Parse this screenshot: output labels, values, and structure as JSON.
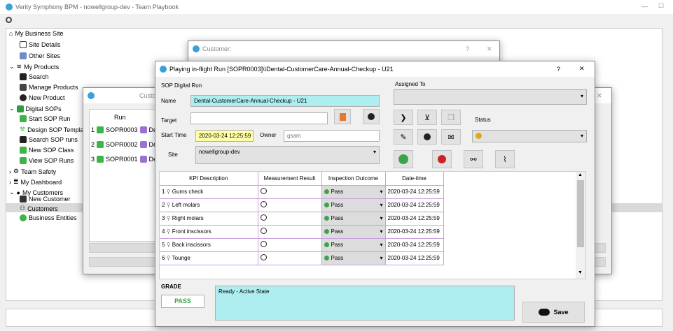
{
  "app": {
    "title": "Verity Symphony BPM - nowellgroup-dev - Team Playbook",
    "minimize": "—",
    "maximize": "☐"
  },
  "tree": {
    "items": [
      {
        "label": "My Business Site"
      },
      {
        "label": "Site Details"
      },
      {
        "label": "Other Sites"
      },
      {
        "label": "My Products"
      },
      {
        "label": "Search"
      },
      {
        "label": "Manage Products"
      },
      {
        "label": "New Product"
      },
      {
        "label": "Digital SOPs"
      },
      {
        "label": "Start SOP Run"
      },
      {
        "label": "Design SOP Templates"
      },
      {
        "label": "Search SOP runs"
      },
      {
        "label": "New SOP Class"
      },
      {
        "label": "View SOP Runs"
      },
      {
        "label": "Team Safety"
      },
      {
        "label": "My Dashboard"
      },
      {
        "label": "My Customers"
      },
      {
        "label": "New Customer"
      },
      {
        "label": "Customers"
      },
      {
        "label": "Business Entities"
      }
    ]
  },
  "customer_dialog": {
    "title": "Customer:",
    "help": "?",
    "close": "✕"
  },
  "runs_dialog": {
    "title": "Custo",
    "close": "✕",
    "header": "Run",
    "rows": [
      {
        "num": "1",
        "run": "SOPR0003",
        "tag": "De"
      },
      {
        "num": "2",
        "run": "SOPR0002",
        "tag": "De"
      },
      {
        "num": "3",
        "run": "SOPR0001",
        "tag": "De"
      }
    ]
  },
  "main": {
    "title": "Playing in-flight  Run [SOPR0003]\\\\Dental-CustomerCare-Annual-Checkup - U21",
    "help": "?",
    "close": "✕",
    "section": "SOP Digital Run",
    "name_label": "Name",
    "name_value": "Dental-CustomerCare-Annual-Checkup - U21",
    "target_label": "Target",
    "target_value": "",
    "start_label": "Start Time",
    "start_value": "2020-03-24 12:25:59",
    "owner_label": "Owner",
    "owner_value": "gsam",
    "site_label": "Site",
    "site_value": "nowellgroup-dev",
    "assigned_label": "Assigned To",
    "assigned_value": "",
    "status_label": "Status",
    "status_value": "",
    "table": {
      "headers": [
        "KPI Description",
        "Measurement Result",
        "Inspection Outcome",
        "Date-time"
      ],
      "rows": [
        {
          "n": "1",
          "kpi": "Gums check",
          "outcome": "Pass",
          "dt": "2020-03-24 12:25:59"
        },
        {
          "n": "2",
          "kpi": "Left molars",
          "outcome": "Pass",
          "dt": "2020-03-24 12:25:59"
        },
        {
          "n": "3",
          "kpi": "Right molars",
          "outcome": "Pass",
          "dt": "2020-03-24 12:25:59"
        },
        {
          "n": "4",
          "kpi": "Front inscissors",
          "outcome": "Pass",
          "dt": "2020-03-24 12:25:59"
        },
        {
          "n": "5",
          "kpi": "Back inscissors",
          "outcome": "Pass",
          "dt": "2020-03-24 12:25:59"
        },
        {
          "n": "6",
          "kpi": "Tounge",
          "outcome": "Pass",
          "dt": "2020-03-24 12:25:59"
        }
      ]
    },
    "grade_label": "GRADE",
    "grade_value": "PASS",
    "status_text": "Ready - Active State",
    "save_label": "Save"
  },
  "colors": {
    "accent": "#3aa0d8",
    "cyan": "#aeeef0",
    "yellow": "#ffffa8",
    "grade": "#3ca34a",
    "pink": "#c9a0dc"
  }
}
